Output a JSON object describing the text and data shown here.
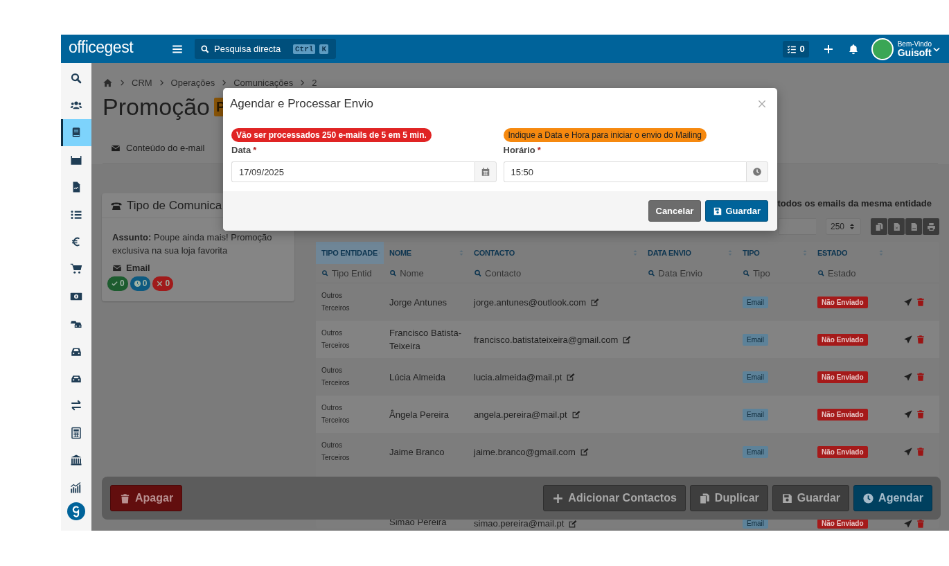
{
  "topbar": {
    "logo": "officegest",
    "search": {
      "placeholder": "Pesquisa directa",
      "keys": [
        "Ctrl",
        "K"
      ]
    },
    "tasks_count": "0",
    "greeting": "Bem-Vindo",
    "user": "Guisoft"
  },
  "sidebar": {
    "items": [
      {
        "selected": false
      },
      {
        "selected": false
      },
      {
        "selected": true
      },
      {
        "selected": false
      },
      {
        "selected": false
      },
      {
        "selected": false
      },
      {
        "selected": false
      },
      {
        "selected": false
      },
      {
        "selected": false
      },
      {
        "selected": false
      },
      {
        "selected": false
      },
      {
        "selected": false
      },
      {
        "selected": false
      },
      {
        "selected": false
      },
      {
        "selected": false
      },
      {
        "selected": false
      }
    ]
  },
  "breadcrumb": [
    "CRM",
    "Operações",
    "Comunicações",
    "2"
  ],
  "page_title": "Promoção",
  "title_badge": "P",
  "tabs": [
    {
      "label": "Conteúdo do e-mail",
      "selected": false
    }
  ],
  "card": {
    "title": "Tipo de Comunica",
    "subject": "**Assunto:** Poupe ainda mais! Promoção exclusiva na sua loja favorita",
    "channel": "Email",
    "counters": [
      {
        "kind": "sent",
        "count": "0",
        "color": "#1d5c2f"
      },
      {
        "kind": "pending",
        "count": "0",
        "color": "#0e5a80"
      },
      {
        "kind": "failed",
        "count": "0",
        "color": "#a01b1b"
      }
    ]
  },
  "option_label": "todos os emails da mesma entidade",
  "page_size": "250",
  "table": {
    "columns": [
      {
        "label": "TIPO ENTIDADE",
        "placeholder": "Tipo Entid",
        "sorted": true
      },
      {
        "label": "NOME",
        "placeholder": "Nome",
        "sorted": false
      },
      {
        "label": "CONTACTO",
        "placeholder": "Contacto",
        "sorted": false
      },
      {
        "label": "DATA ENVIO",
        "placeholder": "Data Envio",
        "sorted": false
      },
      {
        "label": "TIPO",
        "placeholder": "Tipo",
        "sorted": false
      },
      {
        "label": "ESTADO",
        "placeholder": "Estado",
        "sorted": false
      }
    ],
    "rows": [
      {
        "entity_type": "Outros Terceiros",
        "name": "Jorge Antunes",
        "contact": "jorge.antunes@outlook.com",
        "type": "Email",
        "status": "Não Enviado"
      },
      {
        "entity_type": "Outros Terceiros",
        "name": "Francisco Batista-Teixeira",
        "contact": "francisco.batistateixeira@gmail.com",
        "type": "Email",
        "status": "Não Enviado"
      },
      {
        "entity_type": "Outros Terceiros",
        "name": "Lúcia Almeida",
        "contact": "lucia.almeida@mail.pt",
        "type": "Email",
        "status": "Não Enviado"
      },
      {
        "entity_type": "Outros Terceiros",
        "name": "Ângela Pereira",
        "contact": "angela.pereira@mail.pt",
        "type": "Email",
        "status": "Não Enviado"
      },
      {
        "entity_type": "Outros Terceiros",
        "name": "Jaime Branco",
        "contact": "jaime.branco@gmail.com",
        "type": "Email",
        "status": "Não Enviado"
      },
      {
        "name": "Simão Pereira",
        "contact": "simao.pereira@mail.pt",
        "type": "Email",
        "status": "Não Enviado"
      }
    ]
  },
  "actions": [
    {
      "kind": "delete",
      "label": "Apagar"
    },
    {
      "kind": "add",
      "label": "Adicionar Contactos"
    },
    {
      "kind": "duplicate",
      "label": "Duplicar"
    },
    {
      "kind": "save",
      "label": "Guardar"
    },
    {
      "kind": "schedule",
      "label": "Agendar"
    }
  ],
  "modal": {
    "title": "Agendar e Processar Envio",
    "fields": [
      {
        "kind": "date",
        "alert": "Vão ser processados 250 e-mails de 5 em 5 min.",
        "color": "#e02424",
        "label": "Data",
        "required_mark": "*",
        "value": "17/09/2025"
      },
      {
        "kind": "time",
        "alert": "Indique a Data e Hora para iniciar o envio do Mailing",
        "color": "#f6890f",
        "label": "Horário",
        "required_mark": "*",
        "value": "15:50"
      }
    ],
    "buttons": [
      {
        "kind": "cancel",
        "label": "Cancelar"
      },
      {
        "kind": "save",
        "label": "Guardar"
      }
    ]
  }
}
